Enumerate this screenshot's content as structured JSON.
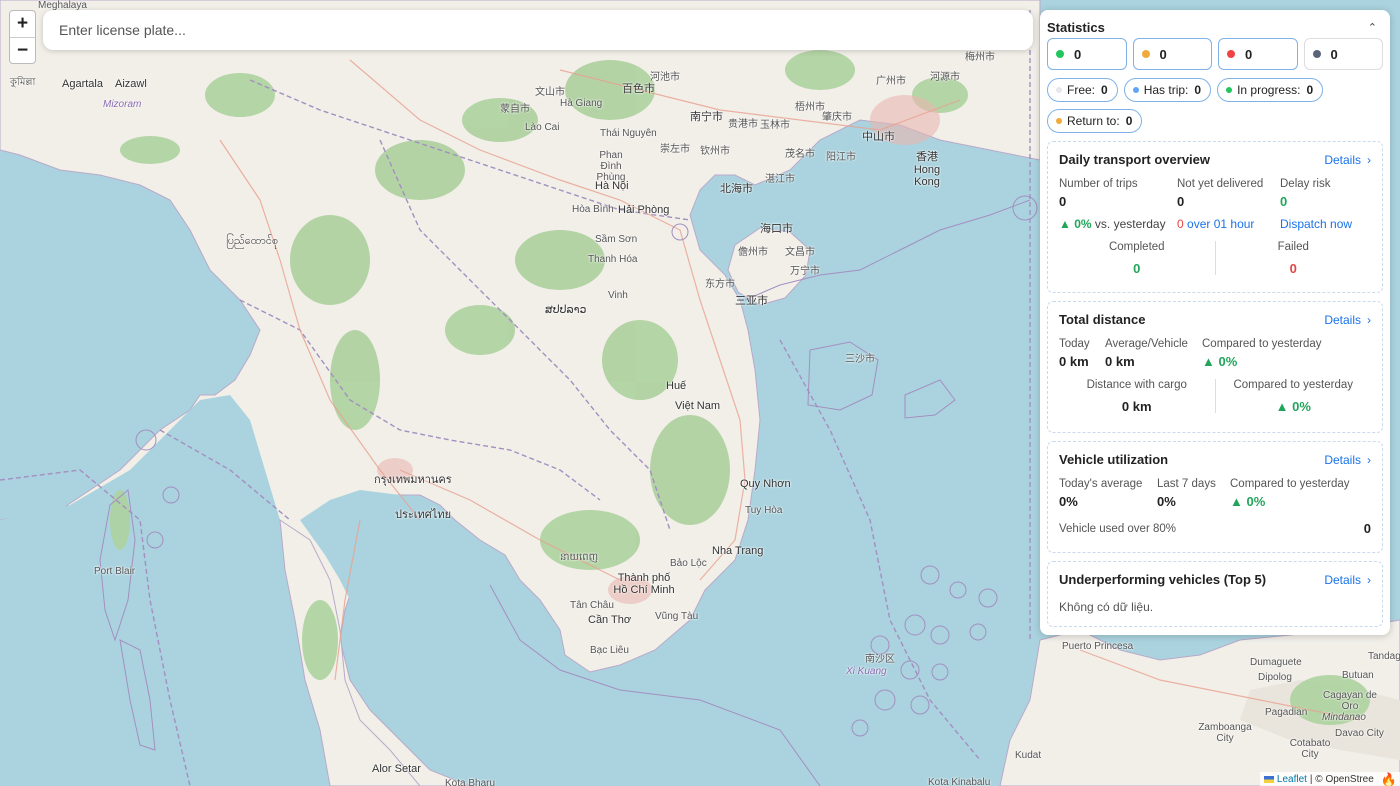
{
  "map": {
    "attribution_link": "Leaflet",
    "attribution_text": "| © OpenStree",
    "places": [
      {
        "t": "Meghalaya"
      },
      {
        "t": "Agartala"
      },
      {
        "t": "Aizawl"
      },
      {
        "t": "Mizoram"
      },
      {
        "t": "কুমিল্লা"
      },
      {
        "t": "河池市"
      },
      {
        "t": "南宁市"
      },
      {
        "t": "贵港市"
      },
      {
        "t": "玉林市"
      },
      {
        "t": "梧州市"
      },
      {
        "t": "肇庆市"
      },
      {
        "t": "广州市"
      },
      {
        "t": "中山市"
      },
      {
        "t": "香港 Hong Kong"
      },
      {
        "t": "河源市"
      },
      {
        "t": "梅州市"
      },
      {
        "t": "百色市"
      },
      {
        "t": "崇左市"
      },
      {
        "t": "钦州市"
      },
      {
        "t": "北海市"
      },
      {
        "t": "湛江市"
      },
      {
        "t": "阳江市"
      },
      {
        "t": "茂名市"
      },
      {
        "t": "海口市"
      },
      {
        "t": "儋州市"
      },
      {
        "t": "文昌市"
      },
      {
        "t": "万宁市"
      },
      {
        "t": "东方市"
      },
      {
        "t": "三亚市"
      },
      {
        "t": "三沙市"
      },
      {
        "t": "蒙自市"
      },
      {
        "t": "文山市"
      },
      {
        "t": "Hà Giang"
      },
      {
        "t": "Lào Cai"
      },
      {
        "t": "Thái Nguyên"
      },
      {
        "t": "Phan Đình Phùng"
      },
      {
        "t": "Hà Nội"
      },
      {
        "t": "Hòa Bình"
      },
      {
        "t": "Hải Phòng"
      },
      {
        "t": "Sầm Sơn"
      },
      {
        "t": "Thanh Hóa"
      },
      {
        "t": "Vinh"
      },
      {
        "t": "Huế"
      },
      {
        "t": "Việt Nam"
      },
      {
        "t": "Quy Nhơn"
      },
      {
        "t": "Tuy Hòa"
      },
      {
        "t": "Nha Trang"
      },
      {
        "t": "Bảo Lộc"
      },
      {
        "t": "Thành phố Hồ Chí Minh"
      },
      {
        "t": "Vũng Tàu"
      },
      {
        "t": "Cần Thơ"
      },
      {
        "t": "Bạc Liêu"
      },
      {
        "t": "Tân Châu"
      },
      {
        "t": "Port Blair"
      },
      {
        "t": "Puerto Princesa"
      },
      {
        "t": "Cagayan de Oro"
      },
      {
        "t": "Mindanao"
      },
      {
        "t": "Davao City"
      },
      {
        "t": "Zamboanga City"
      },
      {
        "t": "Cotabato City"
      },
      {
        "t": "Dumaguete"
      },
      {
        "t": "Kudat"
      },
      {
        "t": "Kota Kinabalu"
      },
      {
        "t": "Alor Setar"
      },
      {
        "t": "Kota Bharu"
      },
      {
        "t": "南沙区"
      },
      {
        "t": "Xi Kuang"
      },
      {
        "t": "Tandag"
      },
      {
        "t": "Butuan"
      },
      {
        "t": "Pagadian"
      },
      {
        "t": "Dipolog"
      },
      {
        "t": "ประเทศไทย"
      },
      {
        "t": "กรุงเทพมหานคร"
      },
      {
        "t": "ပြည်ထောင်စု"
      },
      {
        "t": "នាយពេញ"
      },
      {
        "t": "ສປປລາວ"
      }
    ]
  },
  "zoom": {
    "in": "+",
    "out": "−"
  },
  "search": {
    "placeholder": "Enter license plate..."
  },
  "stats": {
    "title": "Statistics",
    "collapse": "⌃",
    "counters": [
      {
        "color": "#22c55e",
        "value": "0"
      },
      {
        "color": "#f0a93b",
        "value": "0"
      },
      {
        "color": "#ef4444",
        "value": "0"
      },
      {
        "color": "#5b6478",
        "value": "0"
      }
    ],
    "pills": [
      {
        "color": "#e5e7eb",
        "label": "Free:",
        "value": "0"
      },
      {
        "color": "#60a5fa",
        "label": "Has trip:",
        "value": "0"
      },
      {
        "color": "#22c55e",
        "label": "In progress:",
        "value": "0"
      },
      {
        "color": "#f0a93b",
        "label": "Return to:",
        "value": "0"
      }
    ]
  },
  "daily": {
    "title": "Daily transport overview",
    "details": "Details",
    "trips_label": "Number of trips",
    "trips_value": "0",
    "trips_change": "▲ 0%",
    "trips_change_suffix": "vs. yesterday",
    "undelivered_label": "Not yet delivered",
    "undelivered_value": "0",
    "undelivered_red": "0",
    "undelivered_link": "over 01 hour",
    "delay_label": "Delay risk",
    "delay_value": "0",
    "delay_link": "Dispatch now",
    "completed_label": "Completed",
    "completed_value": "0",
    "failed_label": "Failed",
    "failed_value": "0"
  },
  "distance": {
    "title": "Total distance",
    "details": "Details",
    "today_label": "Today",
    "today_value": "0 km",
    "avg_label": "Average/Vehicle",
    "avg_value": "0 km",
    "cmp_label": "Compared to yesterday",
    "cmp_value": "▲ 0%",
    "cargo_label": "Distance with cargo",
    "cargo_value": "0 km",
    "cmp2_label": "Compared to yesterday",
    "cmp2_value": "▲ 0%"
  },
  "utilization": {
    "title": "Vehicle utilization",
    "details": "Details",
    "today_label": "Today's average",
    "today_value": "0%",
    "week_label": "Last 7 days",
    "week_value": "0%",
    "cmp_label": "Compared to yesterday",
    "cmp_value": "▲ 0%",
    "over_label": "Vehicle used over 80%",
    "over_value": "0"
  },
  "underperforming": {
    "title": "Underperforming vehicles (Top 5)",
    "details": "Details",
    "empty": "Không có dữ liệu."
  }
}
